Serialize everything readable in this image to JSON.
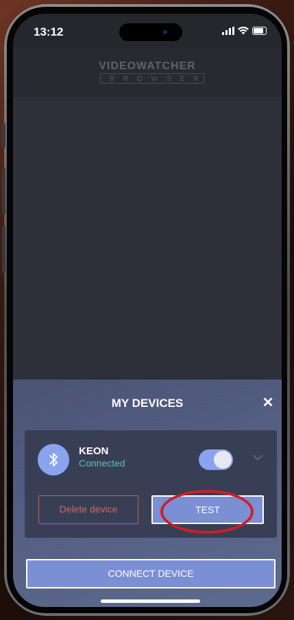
{
  "status_bar": {
    "time": "13:12"
  },
  "app": {
    "logo_title": "VIDEOWATCHER",
    "logo_subtitle": "BROWSER"
  },
  "sheet": {
    "title": "MY DEVICES",
    "close_glyph": "✕",
    "device": {
      "name": "KEON",
      "status": "Connected",
      "icon": "bluetooth-icon",
      "toggle_on": true
    },
    "delete_label": "Delete device",
    "test_label": "TEST",
    "connect_label": "CONNECT DEVICE"
  },
  "colors": {
    "accent": "#7b8fd4",
    "connected": "#59c3b6",
    "danger": "#d46868",
    "highlight": "#d01e25"
  }
}
